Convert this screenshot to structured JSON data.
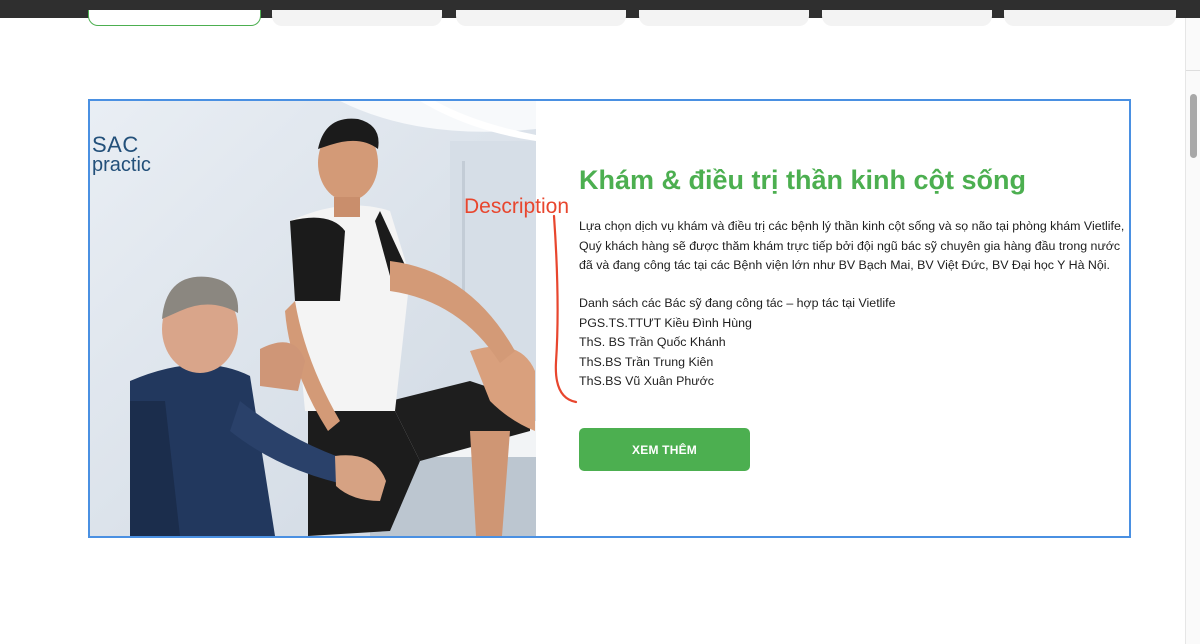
{
  "card": {
    "logo_line1": "SAC",
    "logo_line2": "practic",
    "title": "Khám & điều trị thần kinh cột sống",
    "description": "Lựa chọn dịch vụ khám và điều trị các bệnh lý thần kinh cột sống và sọ não tại phòng khám Vietlife, Quý khách hàng sẽ được thăm khám trực tiếp bởi đội ngũ bác sỹ chuyên gia hàng đầu trong nước đã và đang công tác tại các Bệnh viện lớn như BV Bạch Mai, BV Việt Đức, BV Đại học Y Hà Nội.",
    "doctors_heading": "Danh sách các Bác sỹ đang công tác – hợp tác tại Vietlife",
    "doctors": [
      "PGS.TS.TTƯT Kiều Đình Hùng",
      "ThS. BS Trần Quốc Khánh",
      "ThS.BS Trần Trung Kiên",
      "ThS.BS Vũ Xuân Phước"
    ],
    "button_label": "XEM THÊM"
  },
  "annotation": {
    "label": "Description",
    "color": "#e8462e"
  },
  "colors": {
    "accent_green": "#4caf50",
    "highlight_border": "#4a90e2"
  }
}
